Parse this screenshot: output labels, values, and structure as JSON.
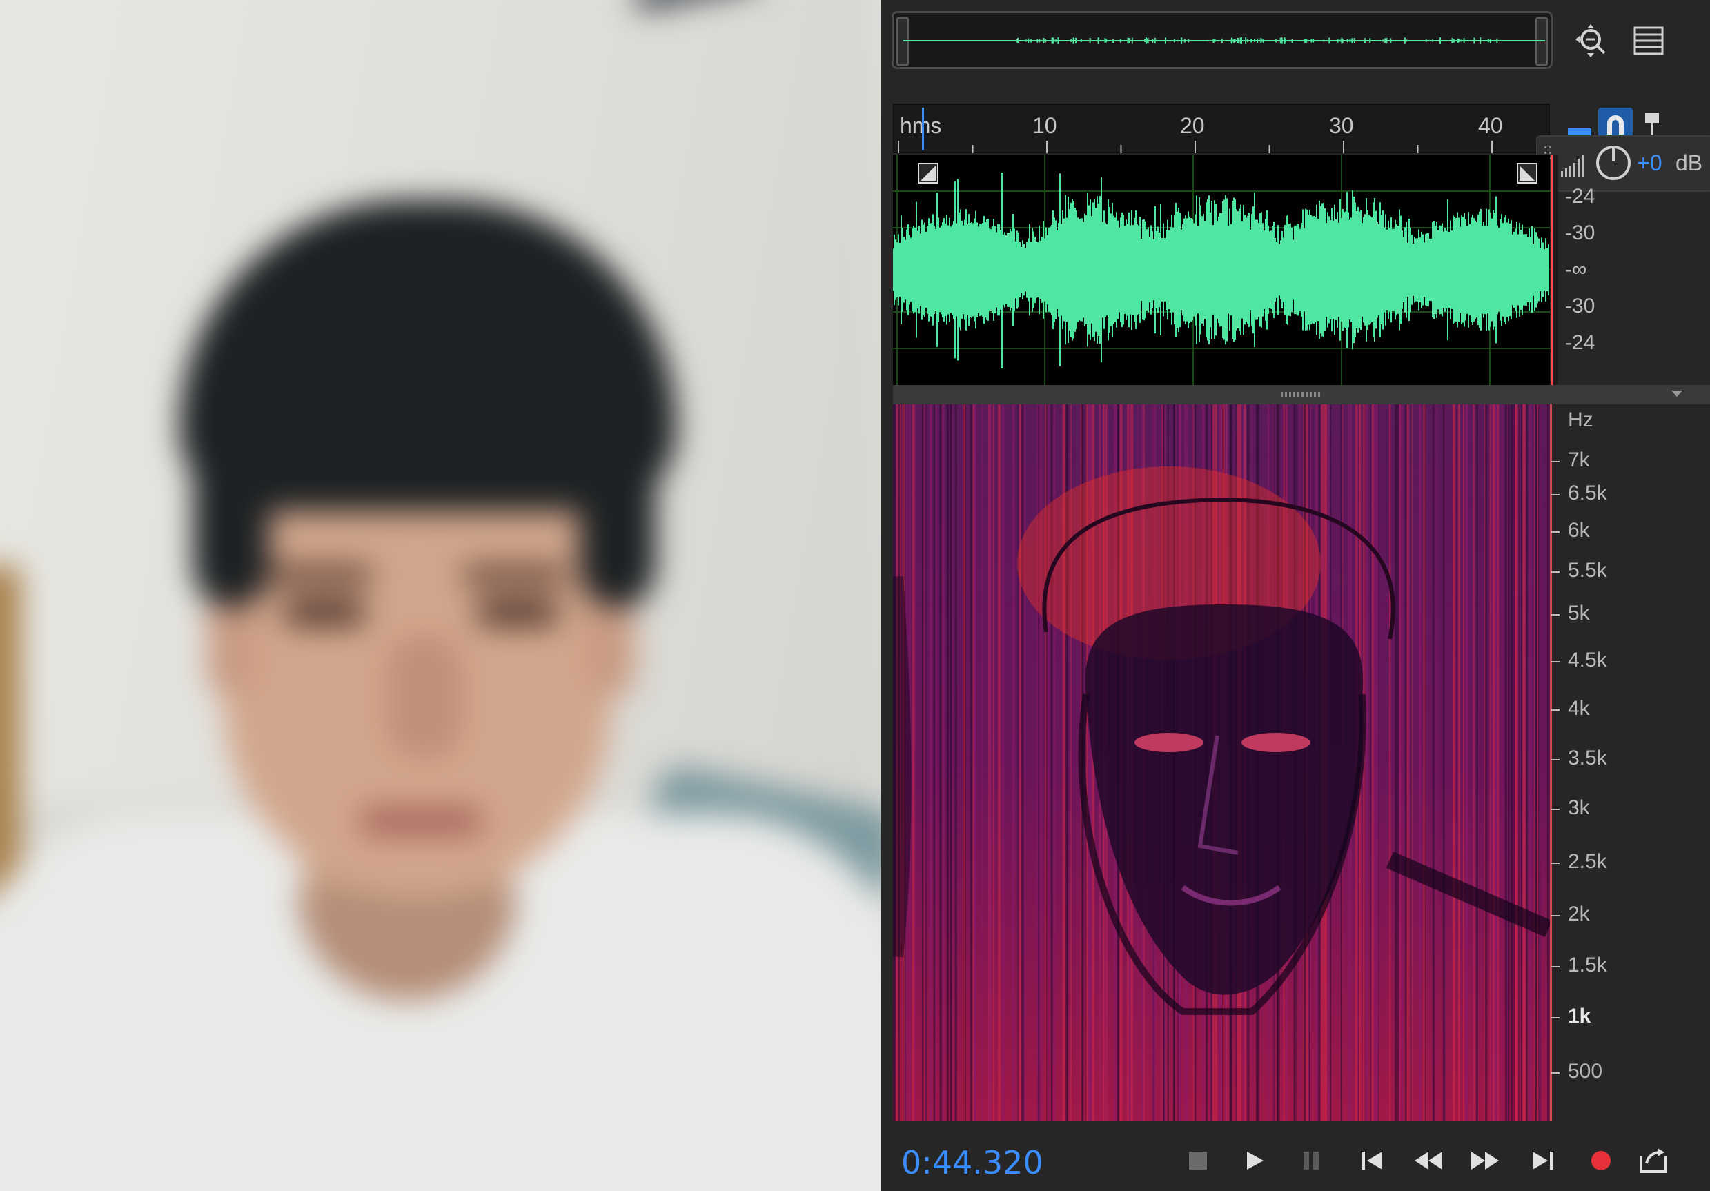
{
  "photo": {
    "description_icon": "camera-preview"
  },
  "editor": {
    "ruler": {
      "unit": "hms",
      "ticks": [
        "10",
        "20",
        "30",
        "40"
      ]
    },
    "waveform": {
      "db_labels": [
        "-24",
        "-30",
        "-∞",
        "-30",
        "-24"
      ]
    },
    "volume": {
      "value": "+0",
      "unit": "dB"
    },
    "spectrogram": {
      "unit": "Hz",
      "labels": [
        "7k",
        "6.5k",
        "6k",
        "5.5k",
        "5k",
        "4.5k",
        "4k",
        "3.5k",
        "3k",
        "2.5k",
        "2k",
        "1.5k",
        "1k",
        "500"
      ]
    },
    "transport": {
      "time": "0:44.320"
    },
    "colors": {
      "accent": "#3a8eff",
      "waveform": "#4ee6a0",
      "record": "#e8303a",
      "playhead": "#ff4a4a"
    }
  }
}
